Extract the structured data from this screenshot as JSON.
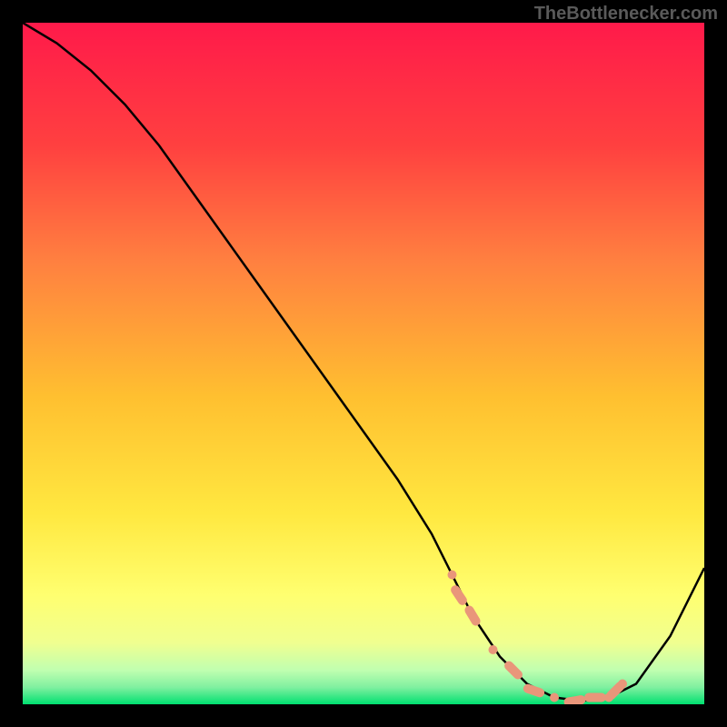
{
  "watermark": "TheBottlenecker.com",
  "chart_data": {
    "type": "line",
    "title": "",
    "xlabel": "",
    "ylabel": "",
    "xlim": [
      0,
      100
    ],
    "ylim": [
      0,
      100
    ],
    "background_gradient": {
      "top": "#ff1a4a",
      "upper_mid": "#ff8040",
      "mid": "#ffd030",
      "lower_mid": "#ffff60",
      "near_bottom": "#e0ff90",
      "bottom": "#00e070"
    },
    "series": [
      {
        "name": "bottleneck-curve",
        "color": "#000000",
        "x": [
          0,
          5,
          10,
          15,
          20,
          25,
          30,
          35,
          40,
          45,
          50,
          55,
          60,
          63,
          66,
          70,
          74,
          78,
          82,
          86,
          90,
          95,
          100
        ],
        "y": [
          100,
          97,
          93,
          88,
          82,
          75,
          68,
          61,
          54,
          47,
          40,
          33,
          25,
          19,
          13,
          7,
          3,
          1,
          0.5,
          1,
          3,
          10,
          20
        ]
      }
    ],
    "markers": {
      "name": "optimal-range",
      "color": "#e9967a",
      "x": [
        63,
        64,
        66,
        69,
        72,
        75,
        78,
        81,
        84,
        86,
        87,
        88
      ],
      "y": [
        19,
        16,
        13,
        8,
        5,
        2,
        1,
        0.5,
        1,
        1,
        2,
        3
      ]
    }
  }
}
